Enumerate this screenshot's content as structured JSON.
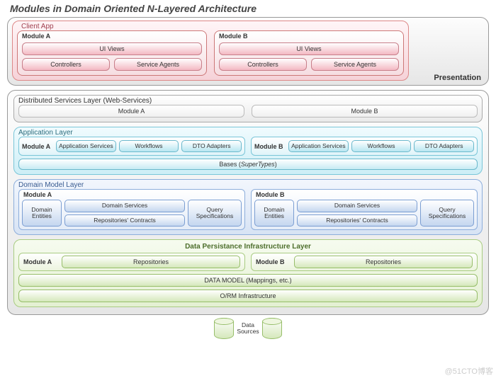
{
  "title": "Modules in Domain Oriented N-Layered Architecture",
  "presentation": {
    "layer_label": "Presentation",
    "client_app": "Client App",
    "modules": [
      {
        "name": "Module A",
        "ui": "UI Views",
        "controllers": "Controllers",
        "agents": "Service Agents"
      },
      {
        "name": "Module B",
        "ui": "UI Views",
        "controllers": "Controllers",
        "agents": "Service Agents"
      }
    ]
  },
  "distributed": {
    "title": "Distributed Services Layer (Web-Services)",
    "modules": [
      "Module A",
      "Module B"
    ]
  },
  "application": {
    "title": "Application Layer",
    "modules": [
      {
        "name": "Module A",
        "boxes": [
          "Application Services",
          "Workflows",
          "DTO Adapters"
        ]
      },
      {
        "name": "Module B",
        "boxes": [
          "Application Services",
          "Workflows",
          "DTO Adapters"
        ]
      }
    ],
    "bases_prefix": "Bases (",
    "bases_em": "SuperTypes",
    "bases_suffix": ")"
  },
  "domain": {
    "title": "Domain Model Layer",
    "modules": [
      {
        "name": "Module A",
        "entities": "Domain Entities",
        "services": "Domain Services",
        "repos": "Repositories' Contracts",
        "query": "Query Specifications"
      },
      {
        "name": "Module B",
        "entities": "Domain Entities",
        "services": "Domain Services",
        "repos": "Repositories' Contracts",
        "query": "Query Specifications"
      }
    ]
  },
  "persistence": {
    "title": "Data Persistance Infrastructure Layer",
    "modules": [
      {
        "name": "Module A",
        "repo": "Repositories"
      },
      {
        "name": "Module B",
        "repo": "Repositories"
      }
    ],
    "data_model": "DATA MODEL (Mappings, etc.)",
    "orm": "O/RM Infrastructure"
  },
  "data_sources": "Data Sources",
  "watermark": "@51CTO博客"
}
